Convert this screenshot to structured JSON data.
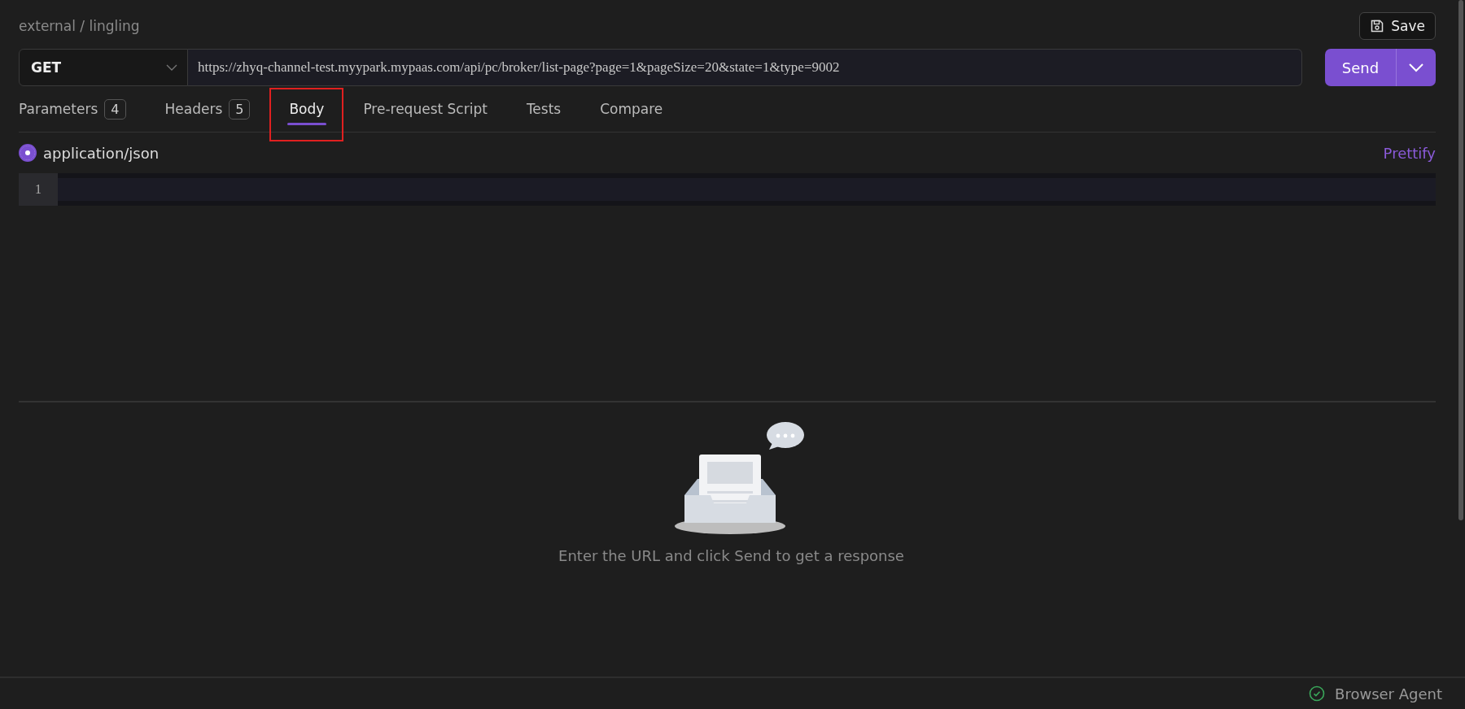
{
  "breadcrumb": "external / lingling",
  "save_button": "Save",
  "request": {
    "method": "GET",
    "url": "https://zhyq-channel-test.myypark.mypaas.com/api/pc/broker/list-page?page=1&pageSize=20&state=1&type=9002",
    "send": "Send"
  },
  "tabs": [
    {
      "label": "Parameters",
      "badge": "4",
      "selected": false,
      "highlighted": false
    },
    {
      "label": "Headers",
      "badge": "5",
      "selected": false,
      "highlighted": false
    },
    {
      "label": "Body",
      "selected": true,
      "highlighted": true
    },
    {
      "label": "Pre-request Script",
      "selected": false,
      "highlighted": false
    },
    {
      "label": "Tests",
      "selected": false,
      "highlighted": false
    },
    {
      "label": "Compare",
      "selected": false,
      "highlighted": false
    }
  ],
  "body_type": {
    "label": "application/json",
    "selected": true
  },
  "prettify": "Prettify",
  "editor": {
    "line_numbers": [
      "1"
    ]
  },
  "response": {
    "message": "Enter the URL and click Send to get a response"
  },
  "status_bar": {
    "agent": "Browser Agent"
  }
}
